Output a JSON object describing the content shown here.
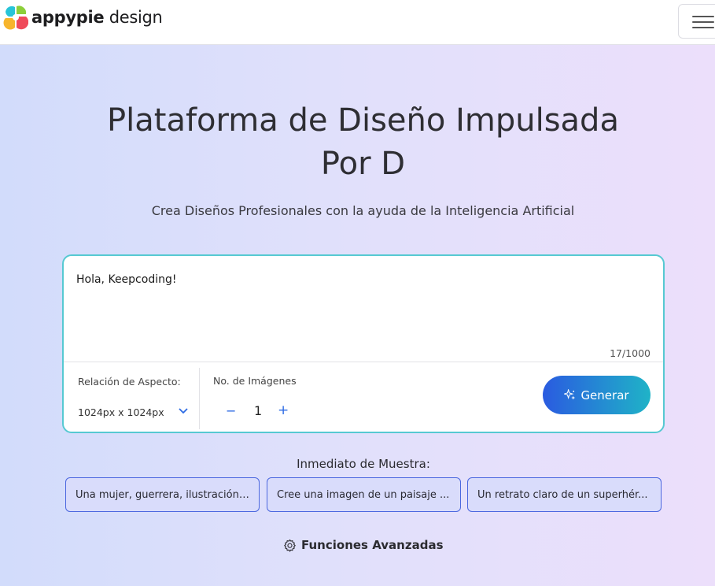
{
  "header": {
    "logo_bold": "appypie",
    "logo_light": " design",
    "menu_icon": "hamburger-icon"
  },
  "hero": {
    "title_line1": "Plataforma de Diseño Impulsada",
    "title_line2": "Por D",
    "subtitle": "Crea Diseños Profesionales con la ayuda de la Inteligencia Artificial"
  },
  "prompt_box": {
    "text": "Hola, Keepcoding!",
    "char_count": "17/1000",
    "border_color": "#56c9d2"
  },
  "controls": {
    "aspect_label": "Relación de Aspecto:",
    "aspect_value": "1024px x 1024px",
    "images_label": "No. de Imágenes",
    "minus": "−",
    "quantity": "1",
    "plus": "+",
    "generate_label": "Generar",
    "generate_icon": "sparkles-icon"
  },
  "samples": {
    "label": "Inmediato de Muestra:",
    "items": [
      "Una mujer, guerrera, ilustración ...",
      "Cree una imagen de un paisaje ...",
      "Un retrato claro de un superhér..."
    ]
  },
  "advanced": {
    "label": "Funciones Avanzadas",
    "icon": "gear-icon"
  },
  "colors": {
    "accent_blue": "#2a5be0",
    "accent_teal": "#1fb3c7",
    "chip_border": "#4b67df"
  }
}
